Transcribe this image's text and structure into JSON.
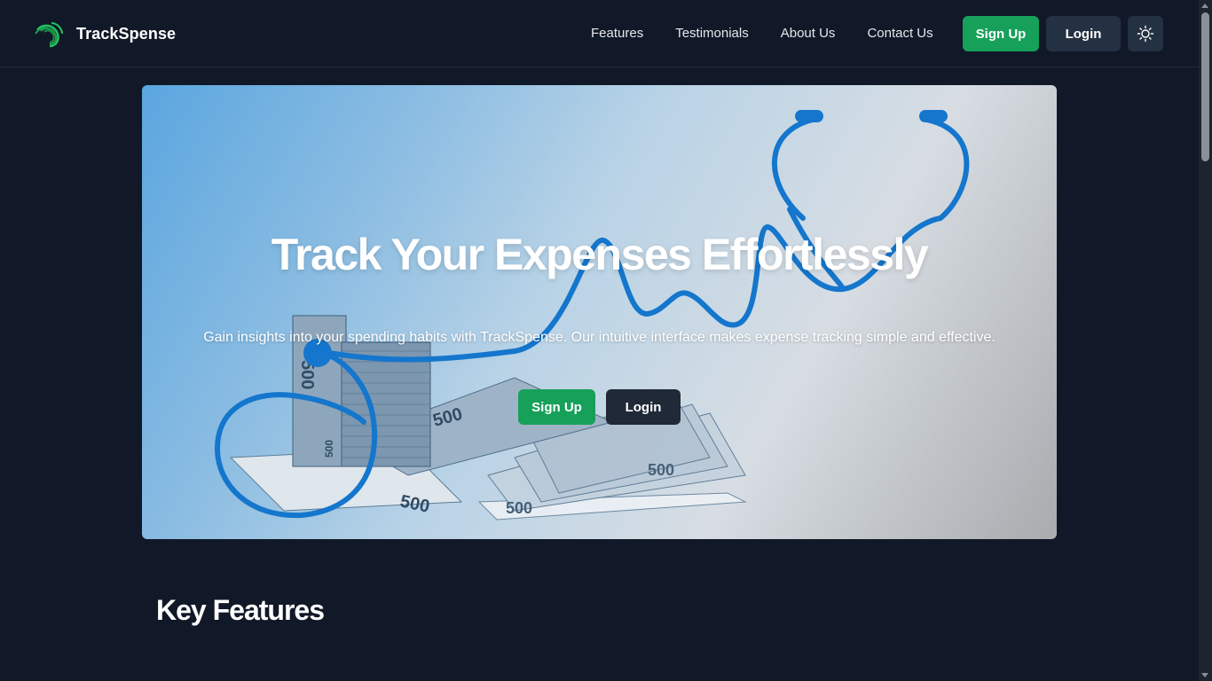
{
  "brand": {
    "name": "TrackSpense",
    "logo_icon": "swirl-logo-icon",
    "logo_color": "#22c55e"
  },
  "nav": {
    "links": [
      "Features",
      "Testimonials",
      "About Us",
      "Contact Us"
    ],
    "signup_label": "Sign Up",
    "login_label": "Login",
    "theme_icon": "sun-icon"
  },
  "hero": {
    "title": "Track Your Expenses Effortlessly",
    "subtitle": "Gain insights into your spending habits with TrackSpense. Our intuitive interface makes expense tracking simple and effective.",
    "signup_label": "Sign Up",
    "login_label": "Login",
    "image_icon": "stethoscope-money-illustration"
  },
  "sections": {
    "key_features_title": "Key Features"
  },
  "colors": {
    "background": "#111827",
    "accent_green": "#16a05a",
    "button_dark": "#243142"
  }
}
